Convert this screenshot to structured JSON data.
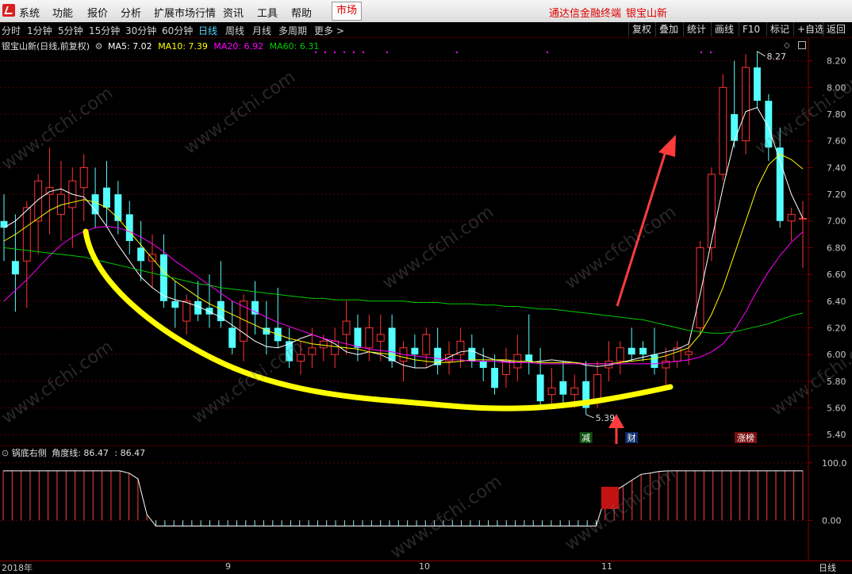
{
  "menubar": {
    "items": [
      "系统",
      "功能",
      "报价",
      "分析",
      "扩展市场行情",
      "资讯",
      "工具",
      "帮助"
    ],
    "market": "市场",
    "brand": "通达信金融终端",
    "stock": "银宝山新"
  },
  "periodbar": {
    "periods": [
      "分时",
      "1分钟",
      "5分钟",
      "15分钟",
      "30分钟",
      "60分钟",
      "日线",
      "周线",
      "月线",
      "多周期",
      "更多 >"
    ],
    "active": "日线",
    "tools": [
      "复权",
      "叠加",
      "统计",
      "画线",
      "F10",
      "标记",
      "+自选",
      "返回"
    ]
  },
  "main_legend": {
    "title": "银宝山新(日线,前复权)",
    "ma5": "MA5: 7.02",
    "ma10": "MA10: 7.39",
    "ma20": "MA20: 6.92",
    "ma60": "MA60: 6.31"
  },
  "indicator_legend": {
    "name": "锅底右侧",
    "line1": "角度线: 86.47",
    "line2": ": 86.47"
  },
  "watermark": "www.cfchi.com",
  "colors": {
    "up": "#ff3232",
    "down": "#54ffff",
    "ma5": "#ffffff",
    "ma10": "#ffff00",
    "ma20": "#ff00ff",
    "ma60": "#00cc00",
    "annotation_curve": "#ffff00",
    "annotation_arrow": "#ff3c3c",
    "axis": "#8b0000"
  },
  "chart_data": [
    {
      "type": "candlestick",
      "series": [
        {
          "name": "MA5",
          "color": "#ffffff",
          "values": [
            6.95,
            7.0,
            7.08,
            7.16,
            7.22,
            7.24,
            7.2,
            7.18,
            7.08,
            6.96,
            6.82,
            6.7,
            6.58,
            6.5,
            6.44,
            6.41,
            6.39,
            6.36,
            6.32,
            6.28,
            6.22,
            6.16,
            6.1,
            6.06,
            6.05,
            6.08,
            6.12,
            6.15,
            6.12,
            6.08,
            6.02,
            6.0,
            6.02,
            6.0,
            5.96,
            5.92,
            5.9,
            5.9,
            5.94,
            5.98,
            6.02,
            6.03,
            5.99,
            5.96,
            5.95,
            5.94,
            5.94,
            5.95,
            5.96,
            5.95,
            5.94,
            5.92,
            5.91,
            5.92,
            5.94,
            5.96,
            5.98,
            6.0,
            6.02,
            6.04,
            6.08,
            6.45,
            6.85,
            7.25,
            7.6,
            7.82,
            7.85,
            7.7,
            7.45,
            7.2,
            7.02
          ]
        },
        {
          "name": "MA10",
          "color": "#ffff00",
          "values": [
            6.85,
            6.9,
            6.96,
            7.02,
            7.08,
            7.12,
            7.14,
            7.16,
            7.14,
            7.1,
            7.02,
            6.92,
            6.82,
            6.72,
            6.62,
            6.55,
            6.49,
            6.43,
            6.38,
            6.34,
            6.3,
            6.26,
            6.22,
            6.18,
            6.15,
            6.12,
            6.1,
            6.08,
            6.07,
            6.06,
            6.05,
            6.04,
            6.02,
            6.01,
            6.0,
            5.98,
            5.96,
            5.95,
            5.94,
            5.94,
            5.95,
            5.96,
            5.96,
            5.96,
            5.96,
            5.95,
            5.95,
            5.94,
            5.94,
            5.94,
            5.94,
            5.93,
            5.93,
            5.93,
            5.94,
            5.95,
            5.96,
            5.97,
            5.99,
            6.02,
            6.05,
            6.15,
            6.3,
            6.5,
            6.75,
            7.0,
            7.25,
            7.42,
            7.5,
            7.46,
            7.39
          ]
        },
        {
          "name": "MA20",
          "color": "#ff00ff",
          "values": [
            6.4,
            6.48,
            6.56,
            6.65,
            6.74,
            6.82,
            6.88,
            6.92,
            6.95,
            6.96,
            6.95,
            6.92,
            6.88,
            6.83,
            6.77,
            6.7,
            6.64,
            6.58,
            6.52,
            6.46,
            6.4,
            6.36,
            6.32,
            6.28,
            6.24,
            6.21,
            6.18,
            6.15,
            6.12,
            6.1,
            6.08,
            6.06,
            6.04,
            6.03,
            6.02,
            6.0,
            5.99,
            5.98,
            5.97,
            5.96,
            5.96,
            5.95,
            5.95,
            5.95,
            5.94,
            5.94,
            5.94,
            5.93,
            5.93,
            5.93,
            5.93,
            5.93,
            5.93,
            5.93,
            5.93,
            5.93,
            5.93,
            5.93,
            5.94,
            5.95,
            5.96,
            5.98,
            6.02,
            6.08,
            6.18,
            6.32,
            6.48,
            6.62,
            6.74,
            6.84,
            6.92
          ]
        },
        {
          "name": "MA60",
          "color": "#00cc00",
          "values": [
            6.8,
            6.79,
            6.78,
            6.77,
            6.76,
            6.75,
            6.74,
            6.73,
            6.71,
            6.69,
            6.67,
            6.65,
            6.63,
            6.61,
            6.59,
            6.57,
            6.55,
            6.53,
            6.52,
            6.5,
            6.49,
            6.48,
            6.47,
            6.46,
            6.45,
            6.44,
            6.43,
            6.42,
            6.42,
            6.41,
            6.41,
            6.41,
            6.4,
            6.4,
            6.4,
            6.4,
            6.39,
            6.39,
            6.39,
            6.38,
            6.38,
            6.38,
            6.37,
            6.37,
            6.36,
            6.36,
            6.35,
            6.34,
            6.34,
            6.33,
            6.32,
            6.31,
            6.3,
            6.29,
            6.28,
            6.27,
            6.26,
            6.24,
            6.22,
            6.2,
            6.18,
            6.17,
            6.16,
            6.16,
            6.17,
            6.19,
            6.21,
            6.23,
            6.26,
            6.29,
            6.31
          ]
        }
      ],
      "candles": [
        {
          "o": 7.0,
          "h": 7.2,
          "l": 6.7,
          "c": 6.95
        },
        {
          "o": 6.7,
          "h": 7.05,
          "l": 6.32,
          "c": 6.6
        },
        {
          "o": 6.7,
          "h": 7.15,
          "l": 6.35,
          "c": 7.1
        },
        {
          "o": 7.0,
          "h": 7.35,
          "l": 6.75,
          "c": 7.3
        },
        {
          "o": 7.2,
          "h": 7.55,
          "l": 6.9,
          "c": 7.25
        },
        {
          "o": 7.05,
          "h": 7.45,
          "l": 6.85,
          "c": 7.2
        },
        {
          "o": 7.1,
          "h": 7.4,
          "l": 6.8,
          "c": 7.3
        },
        {
          "o": 7.25,
          "h": 7.5,
          "l": 7.0,
          "c": 7.4
        },
        {
          "o": 7.2,
          "h": 7.4,
          "l": 6.95,
          "c": 7.05
        },
        {
          "o": 7.25,
          "h": 7.45,
          "l": 6.95,
          "c": 7.1
        },
        {
          "o": 7.2,
          "h": 7.3,
          "l": 6.9,
          "c": 7.0
        },
        {
          "o": 7.05,
          "h": 7.15,
          "l": 6.75,
          "c": 6.85
        },
        {
          "o": 6.8,
          "h": 7.0,
          "l": 6.55,
          "c": 6.7
        },
        {
          "o": 6.7,
          "h": 6.9,
          "l": 6.5,
          "c": 6.75
        },
        {
          "o": 6.75,
          "h": 6.9,
          "l": 6.35,
          "c": 6.4
        },
        {
          "o": 6.4,
          "h": 6.55,
          "l": 6.2,
          "c": 6.35
        },
        {
          "o": 6.25,
          "h": 6.45,
          "l": 6.15,
          "c": 6.4
        },
        {
          "o": 6.4,
          "h": 6.55,
          "l": 6.25,
          "c": 6.3
        },
        {
          "o": 6.35,
          "h": 6.6,
          "l": 6.2,
          "c": 6.3
        },
        {
          "o": 6.4,
          "h": 6.7,
          "l": 6.2,
          "c": 6.25
        },
        {
          "o": 6.2,
          "h": 6.4,
          "l": 6.0,
          "c": 6.05
        },
        {
          "o": 6.1,
          "h": 6.45,
          "l": 5.95,
          "c": 6.4
        },
        {
          "o": 6.4,
          "h": 6.55,
          "l": 6.15,
          "c": 6.3
        },
        {
          "o": 6.2,
          "h": 6.4,
          "l": 6.0,
          "c": 6.15
        },
        {
          "o": 6.2,
          "h": 6.5,
          "l": 6.05,
          "c": 6.1
        },
        {
          "o": 6.1,
          "h": 6.2,
          "l": 5.9,
          "c": 5.95
        },
        {
          "o": 5.95,
          "h": 6.1,
          "l": 5.85,
          "c": 6.0
        },
        {
          "o": 6.0,
          "h": 6.2,
          "l": 5.9,
          "c": 6.05
        },
        {
          "o": 6.05,
          "h": 6.15,
          "l": 5.95,
          "c": 6.1
        },
        {
          "o": 6.0,
          "h": 6.2,
          "l": 5.9,
          "c": 6.1
        },
        {
          "o": 6.15,
          "h": 6.4,
          "l": 6.0,
          "c": 6.25
        },
        {
          "o": 6.2,
          "h": 6.3,
          "l": 5.95,
          "c": 6.05
        },
        {
          "o": 6.05,
          "h": 6.3,
          "l": 5.95,
          "c": 6.2
        },
        {
          "o": 6.1,
          "h": 6.3,
          "l": 5.95,
          "c": 6.15
        },
        {
          "o": 6.2,
          "h": 6.3,
          "l": 5.9,
          "c": 5.95
        },
        {
          "o": 5.95,
          "h": 6.1,
          "l": 5.8,
          "c": 6.05
        },
        {
          "o": 6.05,
          "h": 6.15,
          "l": 5.9,
          "c": 6.0
        },
        {
          "o": 6.0,
          "h": 6.2,
          "l": 5.9,
          "c": 6.15
        },
        {
          "o": 6.05,
          "h": 6.2,
          "l": 5.85,
          "c": 5.92
        },
        {
          "o": 5.95,
          "h": 6.1,
          "l": 5.85,
          "c": 6.0
        },
        {
          "o": 6.0,
          "h": 6.2,
          "l": 5.9,
          "c": 6.1
        },
        {
          "o": 6.05,
          "h": 6.15,
          "l": 5.9,
          "c": 5.95
        },
        {
          "o": 5.95,
          "h": 6.05,
          "l": 5.8,
          "c": 5.9
        },
        {
          "o": 5.9,
          "h": 6.0,
          "l": 5.7,
          "c": 5.75
        },
        {
          "o": 5.85,
          "h": 6.05,
          "l": 5.75,
          "c": 5.95
        },
        {
          "o": 5.9,
          "h": 6.15,
          "l": 5.8,
          "c": 6.0
        },
        {
          "o": 6.0,
          "h": 6.3,
          "l": 5.85,
          "c": 5.95
        },
        {
          "o": 5.85,
          "h": 6.05,
          "l": 5.6,
          "c": 5.65
        },
        {
          "o": 5.7,
          "h": 5.9,
          "l": 5.6,
          "c": 5.75
        },
        {
          "o": 5.8,
          "h": 5.95,
          "l": 5.6,
          "c": 5.7
        },
        {
          "o": 5.7,
          "h": 5.85,
          "l": 5.6,
          "c": 5.75
        },
        {
          "o": 5.8,
          "h": 5.95,
          "l": 5.55,
          "c": 5.6
        },
        {
          "o": 5.65,
          "h": 5.95,
          "l": 5.6,
          "c": 5.85
        },
        {
          "o": 5.9,
          "h": 6.1,
          "l": 5.8,
          "c": 5.95
        },
        {
          "o": 5.95,
          "h": 6.1,
          "l": 5.85,
          "c": 6.05
        },
        {
          "o": 6.05,
          "h": 6.2,
          "l": 5.95,
          "c": 6.0
        },
        {
          "o": 6.05,
          "h": 6.1,
          "l": 5.95,
          "c": 6.0
        },
        {
          "o": 6.0,
          "h": 6.2,
          "l": 5.85,
          "c": 5.9
        },
        {
          "o": 5.9,
          "h": 6.05,
          "l": 5.75,
          "c": 5.95
        },
        {
          "o": 5.95,
          "h": 6.1,
          "l": 5.9,
          "c": 6.05
        },
        {
          "o": 6.0,
          "h": 6.1,
          "l": 5.92,
          "c": 6.02
        },
        {
          "o": 6.2,
          "h": 6.85,
          "l": 6.15,
          "c": 6.8
        },
        {
          "o": 6.8,
          "h": 7.4,
          "l": 6.7,
          "c": 7.35
        },
        {
          "o": 7.35,
          "h": 8.1,
          "l": 7.3,
          "c": 8.0
        },
        {
          "o": 7.8,
          "h": 8.2,
          "l": 7.55,
          "c": 7.6
        },
        {
          "o": 7.6,
          "h": 8.25,
          "l": 7.5,
          "c": 8.15
        },
        {
          "o": 8.15,
          "h": 8.27,
          "l": 7.85,
          "c": 7.9
        },
        {
          "o": 7.9,
          "h": 7.95,
          "l": 7.45,
          "c": 7.55
        },
        {
          "o": 7.55,
          "h": 7.7,
          "l": 6.95,
          "c": 7.0
        },
        {
          "o": 7.0,
          "h": 7.1,
          "l": 6.85,
          "c": 7.05
        },
        {
          "o": 7.02,
          "h": 7.15,
          "l": 6.65,
          "c": 7.02
        }
      ],
      "y_ticks": [
        "8.20",
        "8.00",
        "7.80",
        "7.60",
        "7.40",
        "7.20",
        "7.00",
        "6.80",
        "6.60",
        "6.40",
        "6.20",
        "6.00",
        "5.80",
        "5.60",
        "5.40"
      ],
      "ylim": [
        5.33,
        8.37
      ],
      "price_labels": {
        "high": "8.27",
        "low": "5.39"
      },
      "markers": [
        {
          "text": "减",
          "bg": "#0d4f0d",
          "color": "#ffffff",
          "index": 51
        },
        {
          "text": "财",
          "bg": "#0e2f6b",
          "color": "#ffffff",
          "index": 55
        },
        {
          "text": "涨榜",
          "bg": "#7a1010",
          "color": "#ffffff",
          "index": 65
        }
      ]
    },
    {
      "type": "bar",
      "name": "角度线",
      "values": [
        86,
        86,
        86,
        86,
        86,
        86,
        86,
        86,
        86,
        86,
        86,
        86,
        86,
        86,
        82,
        72,
        10,
        -10,
        -10,
        -10,
        -10,
        -10,
        -10,
        -10,
        -10,
        -10,
        -10,
        -10,
        -10,
        -10,
        -10,
        -10,
        -10,
        -10,
        -10,
        -10,
        -10,
        -10,
        -10,
        -10,
        -10,
        -10,
        -10,
        -10,
        -10,
        -10,
        -10,
        -10,
        -10,
        -10,
        -10,
        -10,
        -10,
        -10,
        -10,
        -10,
        -10,
        -10,
        -10,
        -10,
        -10,
        -10,
        -10,
        -10,
        -10,
        -10,
        -10,
        40,
        50,
        60,
        70,
        80,
        82,
        85,
        86,
        86,
        86,
        86,
        86,
        86,
        86,
        86,
        86,
        86,
        86,
        86,
        86,
        86,
        86,
        86
      ],
      "y_ticks": [
        "100.0",
        "0.00"
      ],
      "ylim": [
        -70,
        130
      ]
    }
  ],
  "x_axis": {
    "labels": [
      "2018年",
      "9",
      "10",
      "11"
    ],
    "right_label": "日线"
  }
}
